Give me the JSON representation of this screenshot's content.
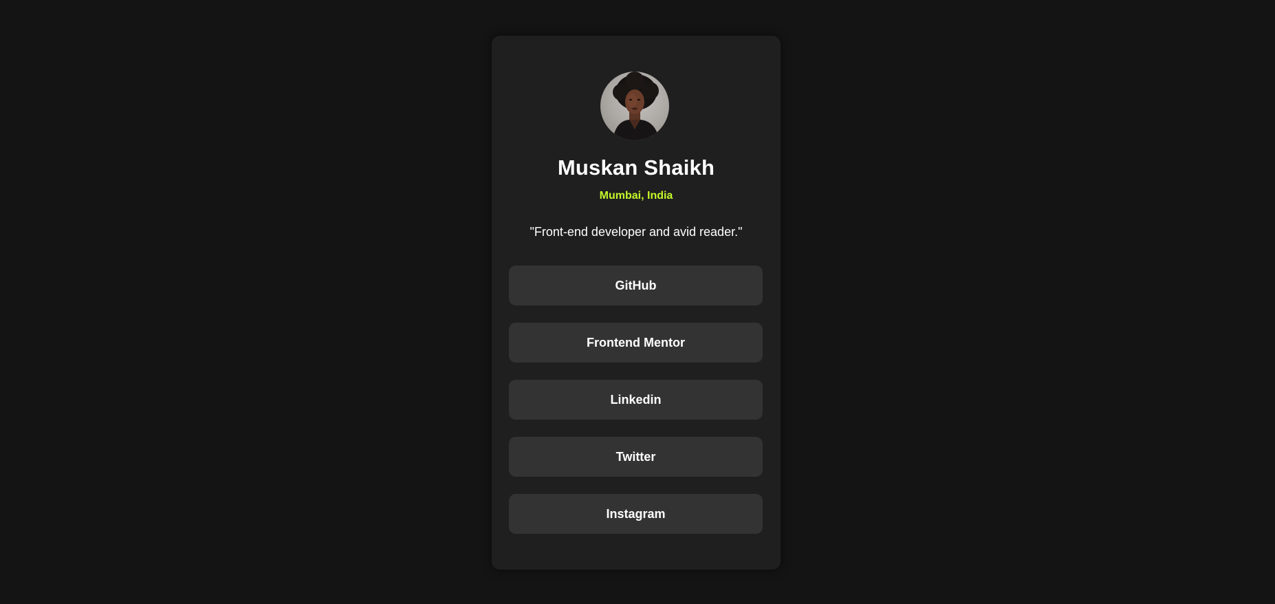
{
  "profile": {
    "avatar_icon": "profile-photo",
    "name": "Muskan Shaikh",
    "location": "Mumbai, India",
    "bio": "\"Front-end developer and avid reader.\""
  },
  "links": [
    {
      "label": "GitHub"
    },
    {
      "label": "Frontend Mentor"
    },
    {
      "label": "Linkedin"
    },
    {
      "label": "Twitter"
    },
    {
      "label": "Instagram"
    }
  ],
  "colors": {
    "page_background": "#141414",
    "card_background": "#1f1f1f",
    "button_background": "#333333",
    "accent": "#c4f82a",
    "text": "#ffffff"
  }
}
